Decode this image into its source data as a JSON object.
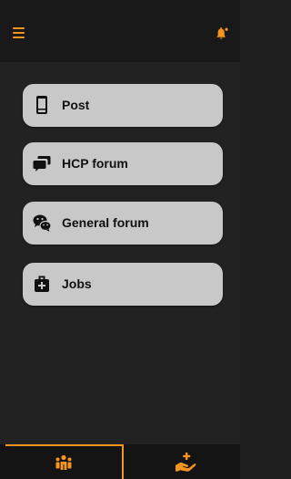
{
  "colors": {
    "accent": "#f7941d",
    "card_bg": "#c8c8c8",
    "header_bg": "#191919",
    "content_bg": "#222222"
  },
  "header": {
    "menu_icon": "hamburger-menu-icon",
    "notification_icon": "bell-icon"
  },
  "menu": {
    "items": [
      {
        "label": "Post",
        "icon": "mobile-document-icon"
      },
      {
        "label": "HCP forum",
        "icon": "chat-bubbles-icon"
      },
      {
        "label": "General forum",
        "icon": "wechat-icon"
      },
      {
        "label": "Jobs",
        "icon": "medical-briefcase-icon"
      }
    ]
  },
  "bottom_nav": {
    "tabs": [
      {
        "icon": "people-group-icon",
        "active": true
      },
      {
        "icon": "hand-holding-medical-icon",
        "active": false
      }
    ]
  }
}
